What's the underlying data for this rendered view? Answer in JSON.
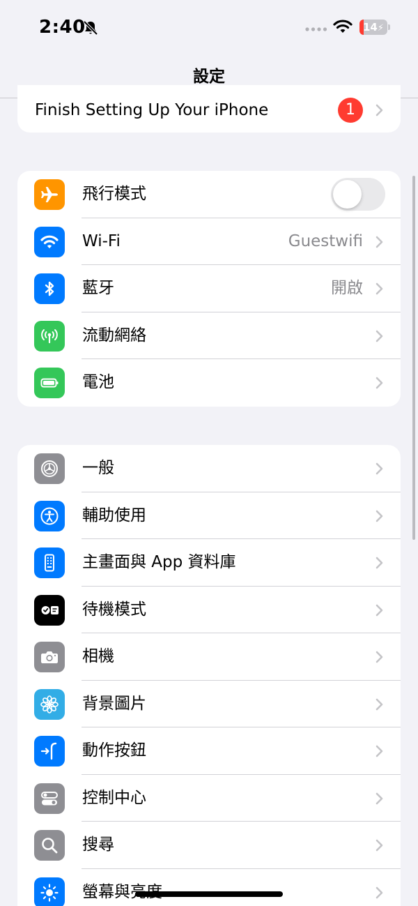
{
  "status_bar": {
    "time": "2:40",
    "battery_percent": "14",
    "battery_level": 0.14
  },
  "nav": {
    "title": "設定"
  },
  "setup_row": {
    "label": "Finish Setting Up Your iPhone",
    "badge": "1"
  },
  "connectivity": {
    "airplane": {
      "label": "飛行模式",
      "enabled": false,
      "icon": "airplane-icon",
      "color": "#ff9500"
    },
    "wifi": {
      "label": "Wi-Fi",
      "value": "Guestwifi",
      "icon": "wifi-icon",
      "color": "#007aff"
    },
    "bluetooth": {
      "label": "藍牙",
      "value": "開啟",
      "icon": "bluetooth-icon",
      "color": "#007aff"
    },
    "cellular": {
      "label": "流動網絡",
      "icon": "cellular-icon",
      "color": "#34c759"
    },
    "battery": {
      "label": "電池",
      "icon": "battery-icon",
      "color": "#34c759"
    }
  },
  "system": [
    {
      "label": "一般",
      "icon": "gear-icon",
      "color": "#8e8e93"
    },
    {
      "label": "輔助使用",
      "icon": "accessibility-icon",
      "color": "#007aff"
    },
    {
      "label": "主畫面與 App 資料庫",
      "icon": "home-screen-icon",
      "color": "#007aff"
    },
    {
      "label": "待機模式",
      "icon": "standby-icon",
      "color": "#000000"
    },
    {
      "label": "相機",
      "icon": "camera-icon",
      "color": "#8e8e93"
    },
    {
      "label": "背景圖片",
      "icon": "wallpaper-icon",
      "color": "#32ade6"
    },
    {
      "label": "動作按鈕",
      "icon": "action-button-icon",
      "color": "#007aff"
    },
    {
      "label": "控制中心",
      "icon": "control-center-icon",
      "color": "#8e8e93"
    },
    {
      "label": "搜尋",
      "icon": "search-icon",
      "color": "#8e8e93"
    },
    {
      "label": "螢幕與亮度",
      "icon": "brightness-icon",
      "color": "#007aff"
    }
  ]
}
